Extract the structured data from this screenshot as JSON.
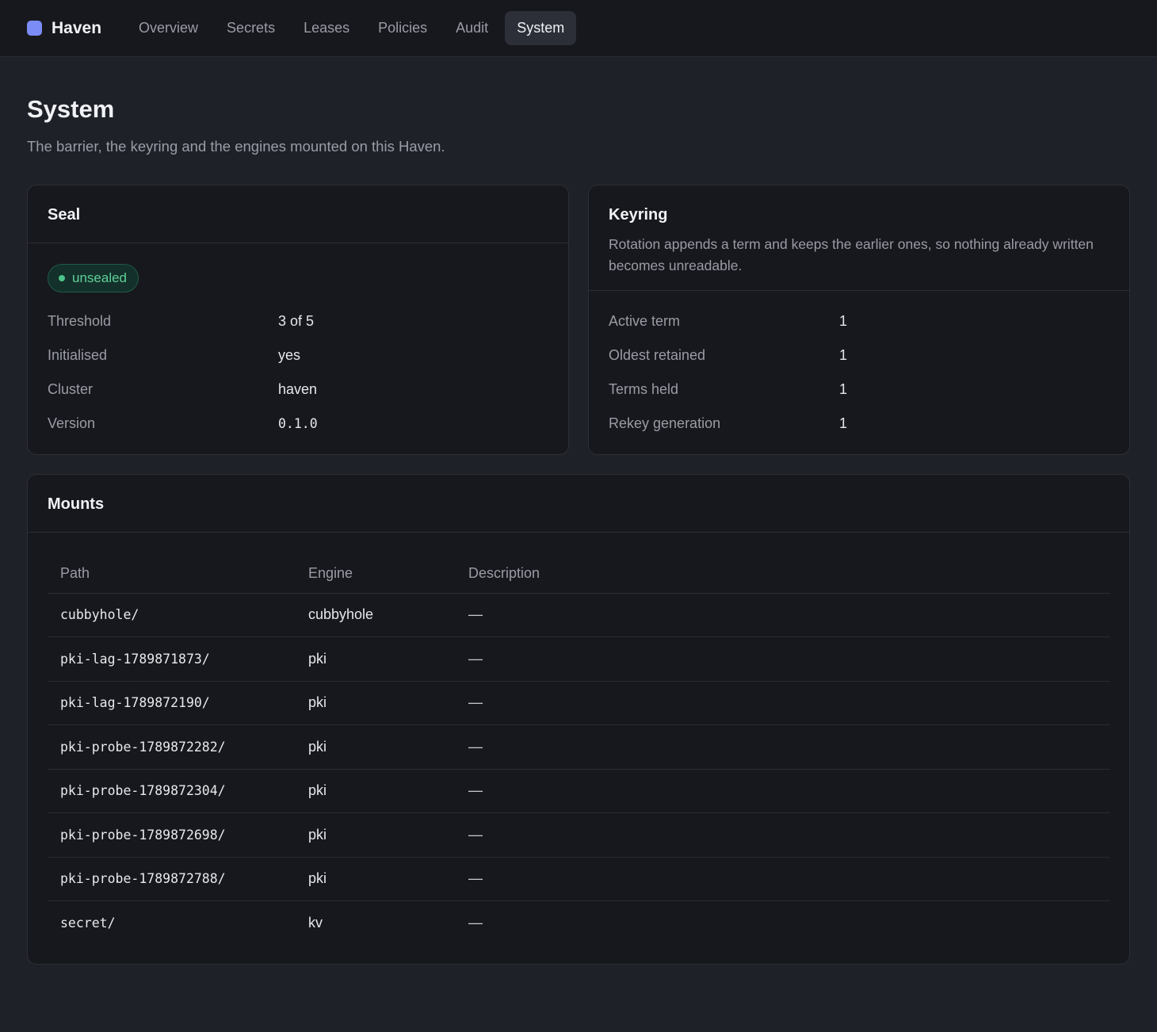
{
  "app": {
    "name": "Haven",
    "accent": "#7b8cf7"
  },
  "nav": {
    "tabs": [
      {
        "label": "Overview"
      },
      {
        "label": "Secrets"
      },
      {
        "label": "Leases"
      },
      {
        "label": "Policies"
      },
      {
        "label": "Audit"
      },
      {
        "label": "System",
        "active": true
      }
    ]
  },
  "page": {
    "title": "System",
    "subtitle": "The barrier, the keyring and the engines mounted on this Haven."
  },
  "seal": {
    "title": "Seal",
    "status": "unsealed",
    "status_color": "#4cc38a",
    "rows": [
      {
        "label": "Threshold",
        "value": "3 of 5"
      },
      {
        "label": "Initialised",
        "value": "yes"
      },
      {
        "label": "Cluster",
        "value": "haven"
      },
      {
        "label": "Version",
        "value": "0.1.0"
      }
    ]
  },
  "keyring": {
    "title": "Keyring",
    "description": "Rotation appends a term and keeps the earlier ones, so nothing already written becomes unreadable.",
    "rows": [
      {
        "label": "Active term",
        "value": "1"
      },
      {
        "label": "Oldest retained",
        "value": "1"
      },
      {
        "label": "Terms held",
        "value": "1"
      },
      {
        "label": "Rekey generation",
        "value": "1"
      }
    ]
  },
  "mounts": {
    "title": "Mounts",
    "columns": [
      "Path",
      "Engine",
      "Description"
    ],
    "rows": [
      {
        "path": "cubbyhole/",
        "engine": "cubbyhole",
        "description": "—"
      },
      {
        "path": "pki-lag-1789871873/",
        "engine": "pki",
        "description": "—"
      },
      {
        "path": "pki-lag-1789872190/",
        "engine": "pki",
        "description": "—"
      },
      {
        "path": "pki-probe-1789872282/",
        "engine": "pki",
        "description": "—"
      },
      {
        "path": "pki-probe-1789872304/",
        "engine": "pki",
        "description": "—"
      },
      {
        "path": "pki-probe-1789872698/",
        "engine": "pki",
        "description": "—"
      },
      {
        "path": "pki-probe-1789872788/",
        "engine": "pki",
        "description": "—"
      },
      {
        "path": "secret/",
        "engine": "kv",
        "description": "—"
      }
    ]
  }
}
